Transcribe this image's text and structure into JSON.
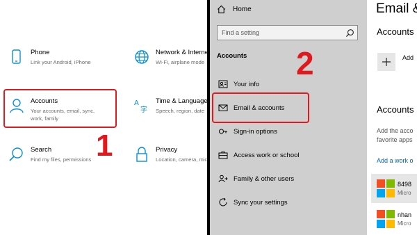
{
  "settings_home": {
    "tiles": [
      {
        "title": "Phone",
        "desc1": "Link your Android, iPhone",
        "desc2": ""
      },
      {
        "title": "Network & Interne",
        "desc1": "Wi-Fi, airplane mode",
        "desc2": ""
      },
      {
        "title": "Accounts",
        "desc1": "Your accounts, email, sync,",
        "desc2": "work, family"
      },
      {
        "title": "Time & Language",
        "desc1": "Speech, region, date",
        "desc2": ""
      },
      {
        "title": "Search",
        "desc1": "Find my files, permissions",
        "desc2": ""
      },
      {
        "title": "Privacy",
        "desc1": "Location, camera, mic",
        "desc2": ""
      }
    ]
  },
  "steps": {
    "one": "1",
    "two": "2"
  },
  "accounts_nav": {
    "home": "Home",
    "search_placeholder": "Find a setting",
    "section": "Accounts",
    "items": [
      {
        "label": "Your info"
      },
      {
        "label": "Email & accounts"
      },
      {
        "label": "Sign-in options"
      },
      {
        "label": "Access work or school"
      },
      {
        "label": "Family & other users"
      },
      {
        "label": "Sync your settings"
      }
    ]
  },
  "email_page": {
    "title": "Email &",
    "accounts_heading_1": "Accounts",
    "add_label": "Add",
    "accounts_heading_2": "Accounts",
    "desc_line1": "Add the acco",
    "desc_line2": "favorite apps",
    "link": "Add a work o",
    "accounts": [
      {
        "name": "8498",
        "type": "Micro"
      },
      {
        "name": "nhan",
        "type": "Micro"
      }
    ]
  },
  "colors": {
    "accent_blue": "#0a8fd6",
    "highlight_red": "#e0191f",
    "nav_background": "#cfcfcf",
    "link_blue": "#0063b1",
    "ms_red": "#f25022",
    "ms_green": "#7fba00",
    "ms_blue": "#00a4ef",
    "ms_yellow": "#ffb900"
  }
}
